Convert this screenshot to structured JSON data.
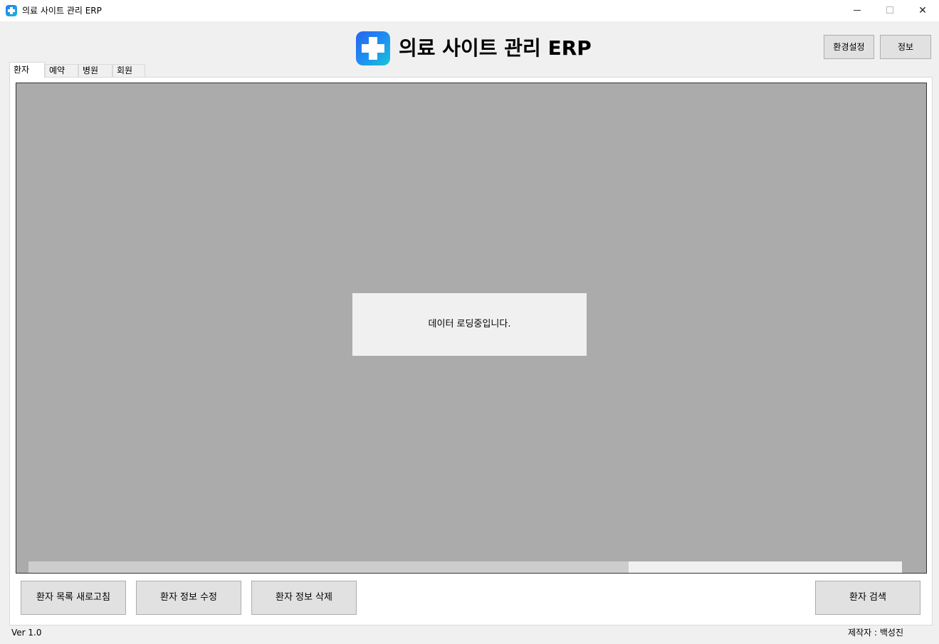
{
  "window": {
    "title": "의료 사이트 관리 ERP",
    "controls": {
      "minimize": "minimize",
      "maximize": "maximize",
      "close": "✕"
    }
  },
  "header": {
    "title": "의료 사이트 관리 ERP",
    "logo_icon": "medical-cross-icon",
    "brand_color": "#1e8ef2",
    "settings_label": "환경설정",
    "info_label": "정보"
  },
  "tabs": [
    {
      "label": "환자",
      "active": true
    },
    {
      "label": "예약",
      "active": false
    },
    {
      "label": "병원",
      "active": false
    },
    {
      "label": "회원",
      "active": false
    }
  ],
  "grid": {
    "loading_message": "데이터 로딩중입니다.",
    "background_color": "#ababab",
    "scroll_position": 0
  },
  "actions": {
    "refresh_label": "환자 목록 새로고침",
    "edit_label": "환자 정보 수정",
    "delete_label": "환자 정보 삭제",
    "search_label": "환자 검색"
  },
  "footer": {
    "version": "Ver 1.0",
    "author": "제작자 : 백성진"
  }
}
